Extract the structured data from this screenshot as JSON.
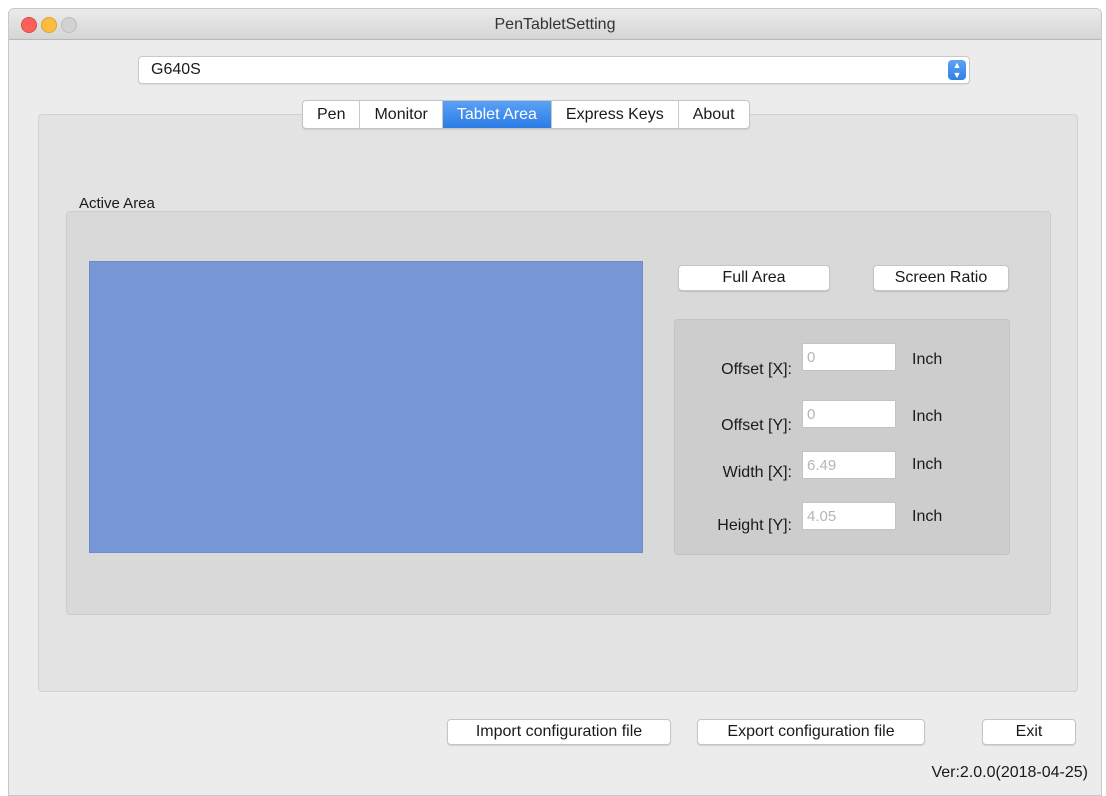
{
  "window": {
    "title": "PenTabletSetting"
  },
  "device": {
    "selected": "G640S"
  },
  "tabs": [
    {
      "label": "Pen"
    },
    {
      "label": "Monitor"
    },
    {
      "label": "Tablet Area"
    },
    {
      "label": "Express Keys"
    },
    {
      "label": "About"
    }
  ],
  "active_tab": "Tablet Area",
  "active_area": {
    "group_label": "Active Area",
    "full_area_label": "Full Area",
    "screen_ratio_label": "Screen Ratio",
    "fields": [
      {
        "label": "Offset [X]:",
        "value": "0",
        "unit": "Inch"
      },
      {
        "label": "Offset [Y]:",
        "value": "0",
        "unit": "Inch"
      },
      {
        "label": "Width [X]:",
        "value": "6.49",
        "unit": "Inch"
      },
      {
        "label": "Height [Y]:",
        "value": "4.05",
        "unit": "Inch"
      }
    ]
  },
  "footer": {
    "import_label": "Import configuration file",
    "export_label": "Export configuration file",
    "exit_label": "Exit",
    "version": "Ver:2.0.0(2018-04-25)"
  },
  "colors": {
    "accent": "#2c7ce4",
    "area_preview": "#7897d7"
  }
}
